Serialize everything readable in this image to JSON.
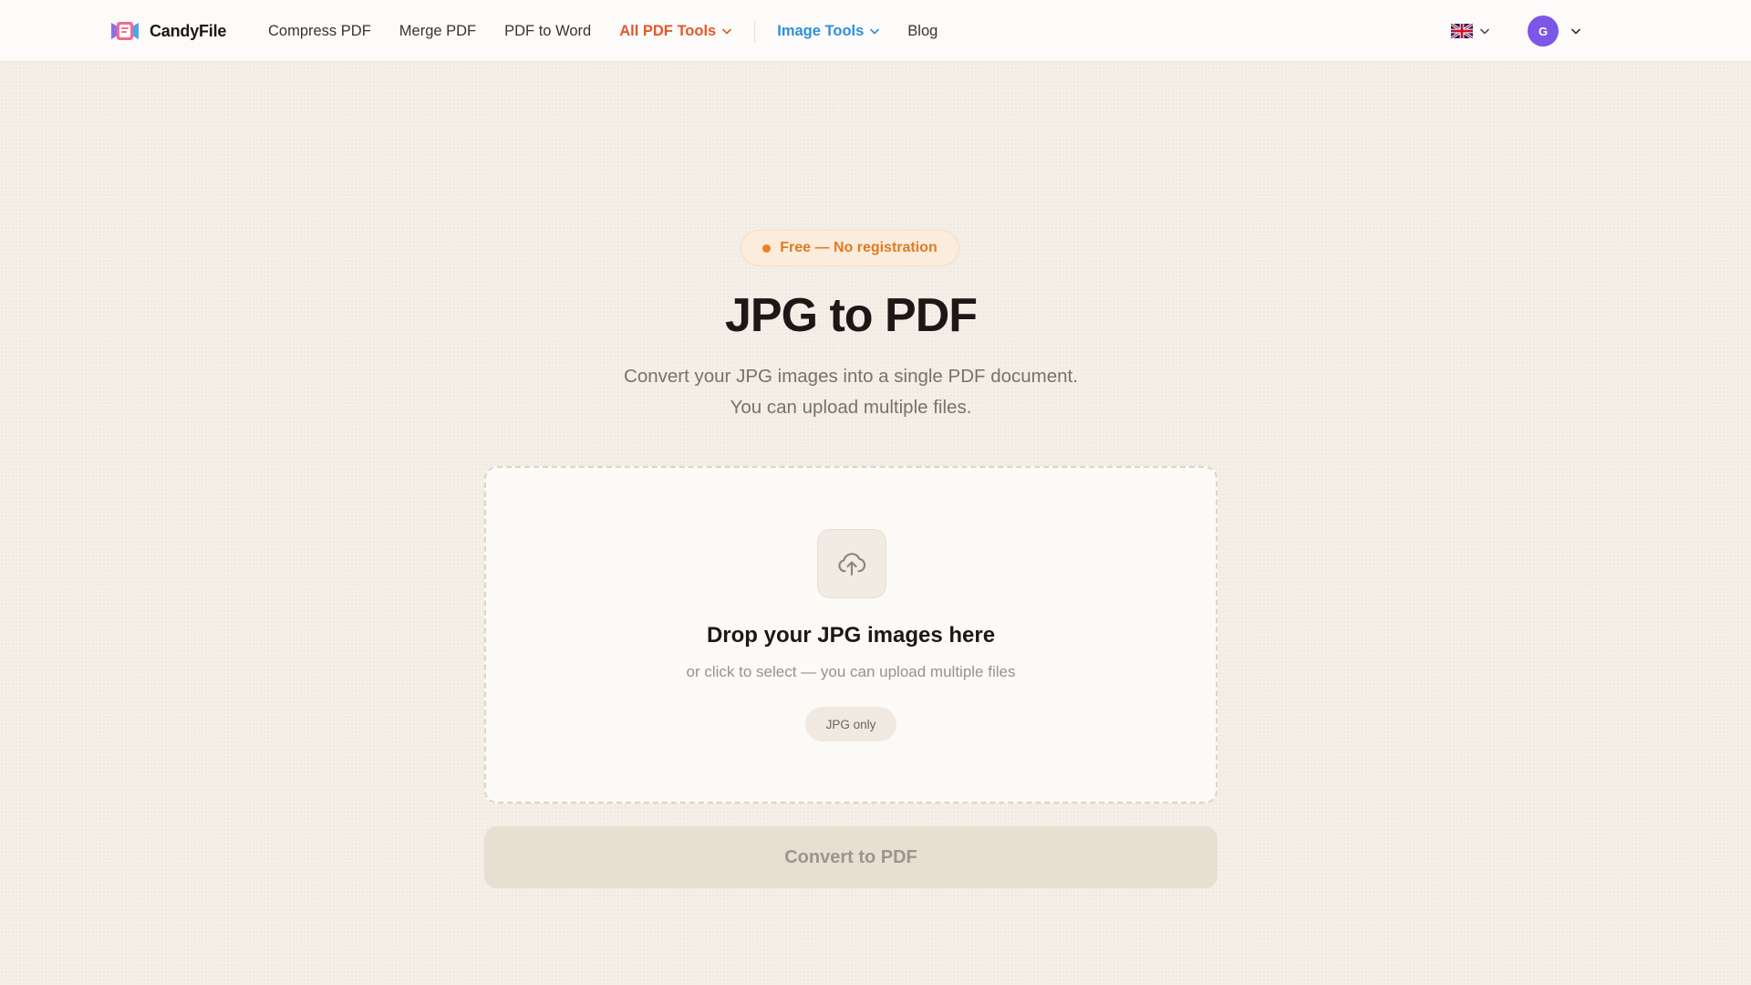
{
  "brand": {
    "name": "CandyFile"
  },
  "nav": {
    "items": [
      {
        "label": "Compress PDF"
      },
      {
        "label": "Merge PDF"
      },
      {
        "label": "PDF to Word"
      },
      {
        "label": "All PDF Tools",
        "dropdown": true,
        "color": "#e0592c"
      },
      {
        "label": "Image Tools",
        "dropdown": true,
        "color": "#2f8fd8"
      },
      {
        "label": "Blog"
      }
    ]
  },
  "language": {
    "icon": "uk-flag-icon"
  },
  "user": {
    "initial": "G",
    "avatar_color": "#7b56e8"
  },
  "hero": {
    "badge": "Free — No registration",
    "title": "JPG to PDF",
    "subtitle_line1": "Convert your JPG images into a single PDF document.",
    "subtitle_line2": "You can upload multiple files."
  },
  "dropzone": {
    "icon": "cloud-upload-icon",
    "title": "Drop your JPG images here",
    "subtitle": "or click to select — you can upload multiple files",
    "chip": "JPG only"
  },
  "action": {
    "convert_label": "Convert to PDF",
    "enabled": false
  },
  "colors": {
    "accent_orange": "#e07b22",
    "background": "#f4efe7",
    "button_disabled": "#e8dfd3"
  }
}
